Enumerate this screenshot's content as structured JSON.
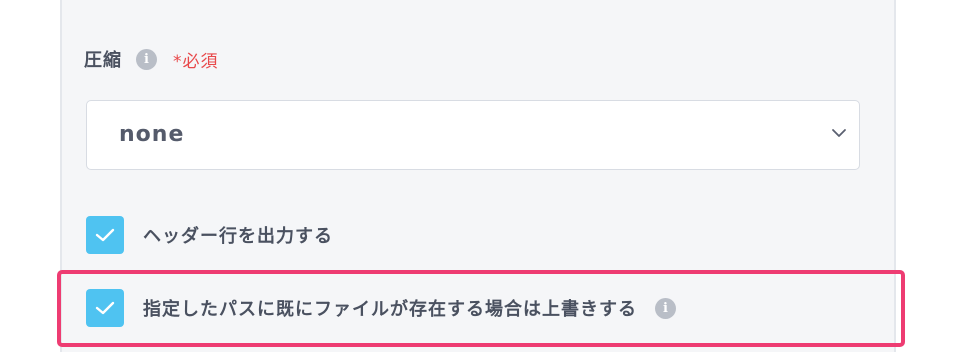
{
  "compression": {
    "label": "圧縮",
    "info_icon": "info-icon",
    "required_text": "*必須",
    "selected_value": "none",
    "dropdown_icon": "chevron-down-icon"
  },
  "options": [
    {
      "label": "ヘッダー行を出力する",
      "checked": true
    },
    {
      "label": "指定したパスに既にファイルが存在する場合は上書きする",
      "checked": true,
      "info_icon": "info-icon"
    }
  ],
  "colors": {
    "checkbox": "#4fc3f1",
    "required": "#e8484a",
    "highlight": "#ee3c72"
  }
}
